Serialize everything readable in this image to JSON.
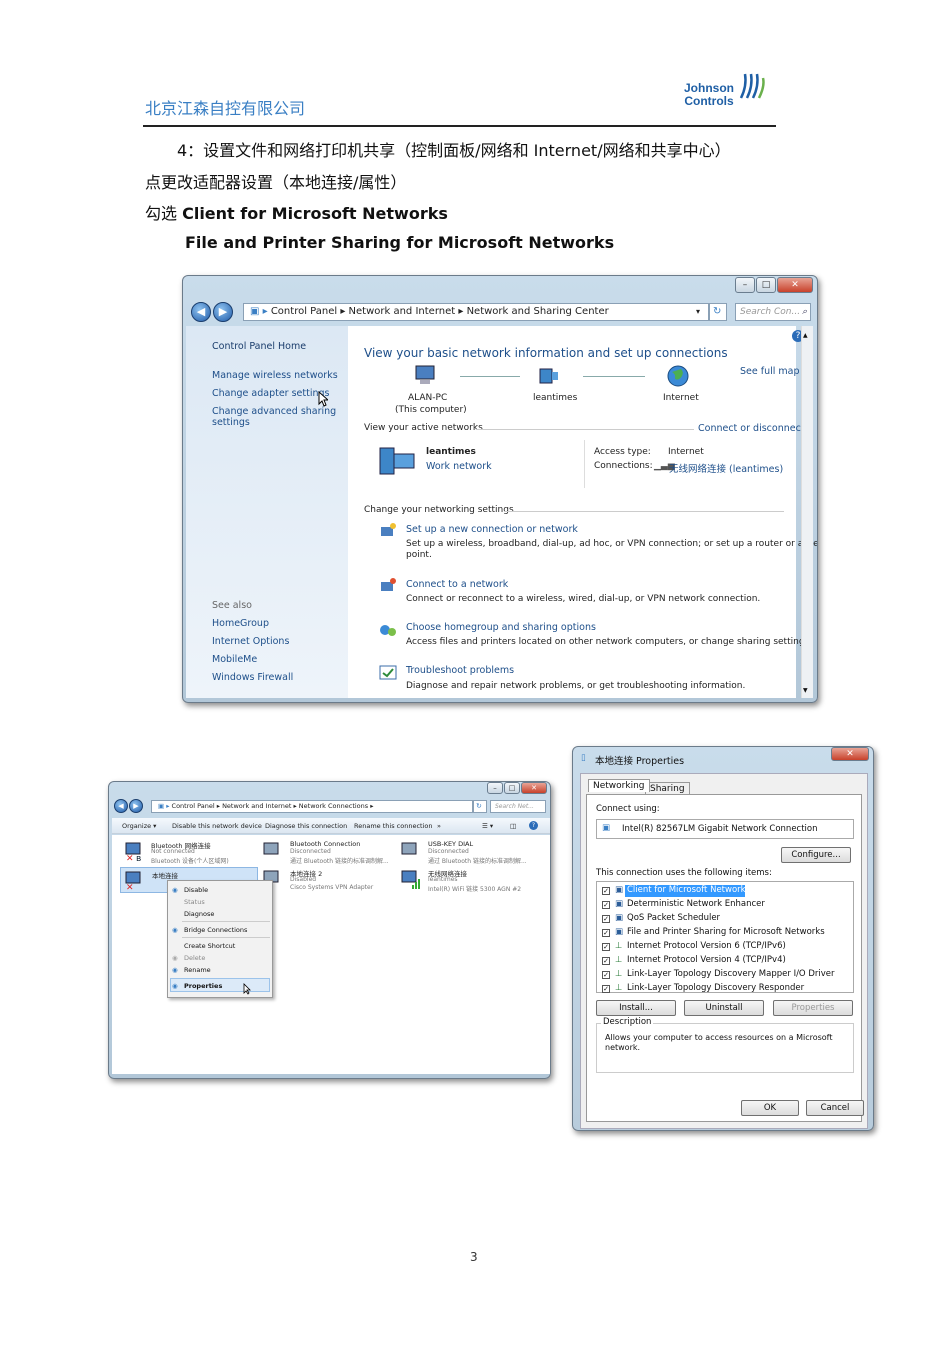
{
  "header": {
    "company": "北京江森自控有限公司",
    "logo_line1": "Johnson",
    "logo_line2": "Controls"
  },
  "body": {
    "line1": "4：设置文件和网络打印机共享（控制面板/网络和 Internet/网络和共享中心）",
    "line2": "点更改适配器设置（本地连接/属性）",
    "line3_prefix": "勾选 ",
    "line3_bold": "Client for Microsoft Networks",
    "line4_bold": "File and Printer Sharing for Microsoft Networks"
  },
  "win1": {
    "breadcrumb": [
      "Control Panel",
      "Network and Internet",
      "Network and Sharing Center"
    ],
    "search_placeholder": "Search Con...",
    "sidebar": {
      "home": "Control Panel Home",
      "items": [
        "Manage wireless networks",
        "Change adapter settings",
        "Change advanced sharing",
        "settings"
      ],
      "see_also": "See also",
      "see_items": [
        "HomeGroup",
        "Internet Options",
        "MobileMe",
        "Windows Firewall"
      ]
    },
    "main": {
      "heading": "View your basic network information and set up connections",
      "see_full_map": "See full map",
      "node1": "ALAN-PC",
      "node1_sub": "(This computer)",
      "node2": "leantimes",
      "node3": "Internet",
      "active_label": "View your active networks",
      "connect_link": "Connect or disconnect",
      "net_name": "leantimes",
      "net_type": "Work network",
      "access_label": "Access type:",
      "access_value": "Internet",
      "conn_label": "Connections:",
      "conn_value": "无线网络连接 (leantimes)",
      "change_label": "Change your networking settings",
      "tasks": [
        {
          "title": "Set up a new connection or network",
          "desc1": "Set up a wireless, broadband, dial-up, ad hoc, or VPN connection; or set up a router or access",
          "desc2": "point."
        },
        {
          "title": "Connect to a network",
          "desc1": "Connect or reconnect to a wireless, wired, dial-up, or VPN network connection.",
          "desc2": ""
        },
        {
          "title": "Choose homegroup and sharing options",
          "desc1": "Access files and printers located on other network computers, or change sharing settings.",
          "desc2": ""
        },
        {
          "title": "Troubleshoot problems",
          "desc1": "Diagnose and repair network problems, or get troubleshooting information.",
          "desc2": ""
        }
      ]
    }
  },
  "win2": {
    "breadcrumb": [
      "Control Panel",
      "Network and Internet",
      "Network Connections"
    ],
    "search_placeholder": "Search Net...",
    "toolbar": [
      "Organize ▾",
      "Disable this network device",
      "Diagnose this connection",
      "Rename this connection",
      "»"
    ],
    "adapters": [
      {
        "name": "Bluetooth 网络连接",
        "status": "Not connected",
        "device": "Bluetooth 设备(个人区域网)"
      },
      {
        "name": "Bluetooth Connection",
        "status": "Disconnected",
        "device": "通过 Bluetooth 链接的标准调制解..."
      },
      {
        "name": "USB-KEY DIAL",
        "status": "Disconnected",
        "device": "通过 Bluetooth 链接的标准调制解..."
      },
      {
        "name": "本地连接",
        "status": "",
        "device": ""
      },
      {
        "name": "本地连接 2",
        "status": "Disabled",
        "device": "Cisco Systems VPN Adapter"
      },
      {
        "name": "无线网络连接",
        "status": "leantimes",
        "device": "Intel(R) WiFi 链接 5300 AGN #2"
      }
    ],
    "menu": [
      "Disable",
      "Status",
      "Diagnose",
      "Bridge Connections",
      "Create Shortcut",
      "Delete",
      "Rename",
      "Properties"
    ]
  },
  "dialog": {
    "title": "本地连接 Properties",
    "tabs": [
      "Networking",
      "Sharing"
    ],
    "connect_using": "Connect using:",
    "adapter": "Intel(R) 82567LM Gigabit Network Connection",
    "configure": "Configure...",
    "items_label": "This connection uses the following items:",
    "items": [
      "Client for Microsoft Networks",
      "Deterministic Network Enhancer",
      "QoS Packet Scheduler",
      "File and Printer Sharing for Microsoft Networks",
      "Internet Protocol Version 6 (TCP/IPv6)",
      "Internet Protocol Version 4 (TCP/IPv4)",
      "Link-Layer Topology Discovery Mapper I/O Driver",
      "Link-Layer Topology Discovery Responder"
    ],
    "install": "Install...",
    "uninstall": "Uninstall",
    "properties": "Properties",
    "desc_label": "Description",
    "desc1": "Allows your computer to access resources on a Microsoft",
    "desc2": "network.",
    "ok": "OK",
    "cancel": "Cancel"
  },
  "footer": {
    "page": "3"
  },
  "colors": {
    "link": "#1f5fb8",
    "header_blue": "#3a7fc4",
    "select": "#3399ff"
  }
}
